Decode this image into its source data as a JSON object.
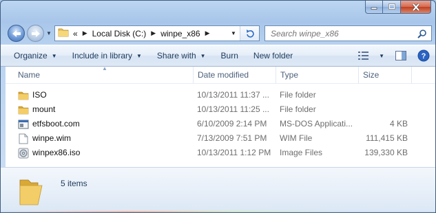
{
  "window": {
    "controls": {
      "minimize": "minimize-icon",
      "maximize": "maximize-icon",
      "close": "close-icon"
    }
  },
  "address_bar": {
    "overflow": "«",
    "crumbs": [
      "Local Disk (C:)",
      "winpe_x86"
    ]
  },
  "search": {
    "placeholder": "Search winpe_x86"
  },
  "toolbar": {
    "organize": "Organize",
    "include_in_library": "Include in library",
    "share_with": "Share with",
    "burn": "Burn",
    "new_folder": "New folder"
  },
  "columns": {
    "name": "Name",
    "date_modified": "Date modified",
    "type": "Type",
    "size": "Size"
  },
  "files": [
    {
      "name": "ISO",
      "date": "10/13/2011 11:37 ...",
      "type": "File folder",
      "size": "",
      "icon": "folder-icon"
    },
    {
      "name": "mount",
      "date": "10/13/2011 11:25 ...",
      "type": "File folder",
      "size": "",
      "icon": "folder-icon"
    },
    {
      "name": "etfsboot.com",
      "date": "6/10/2009 2:14 PM",
      "type": "MS-DOS Applicati...",
      "size": "4 KB",
      "icon": "application-icon"
    },
    {
      "name": "winpe.wim",
      "date": "7/13/2009 7:51 PM",
      "type": "WIM File",
      "size": "111,415 KB",
      "icon": "file-icon"
    },
    {
      "name": "winpex86.iso",
      "date": "10/13/2011 1:12 PM",
      "type": "Image Files",
      "size": "139,330 KB",
      "icon": "disc-image-icon"
    }
  ],
  "details": {
    "count": "5 items"
  }
}
